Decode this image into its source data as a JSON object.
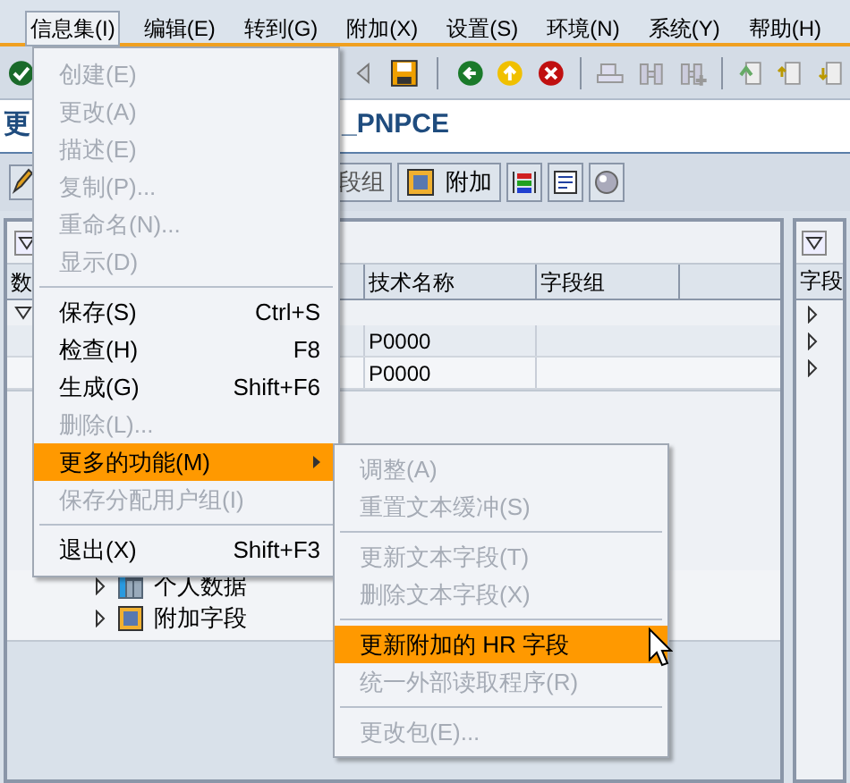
{
  "menu_bar": [
    {
      "label": "信息集(I)",
      "selected": true
    },
    {
      "label": "编辑(E)",
      "selected": false
    },
    {
      "label": "转到(G)",
      "selected": false
    },
    {
      "label": "附加(X)",
      "selected": false
    },
    {
      "label": "设置(S)",
      "selected": false
    },
    {
      "label": "环境(N)",
      "selected": false
    },
    {
      "label": "系统(Y)",
      "selected": false
    },
    {
      "label": "帮助(H)",
      "selected": false
    }
  ],
  "title": {
    "start": "更",
    "end": "_PNPCE"
  },
  "app_toolbar": {
    "partial_button": "段组",
    "button": "附加"
  },
  "table": {
    "columns": [
      {
        "label": "数"
      },
      {
        "label": "技术名称"
      },
      {
        "label": "字段组"
      }
    ],
    "rows": [
      {
        "technical_name": "P0000"
      },
      {
        "technical_name": "P0000"
      }
    ]
  },
  "tree": [
    {
      "label": "个人数据"
    },
    {
      "label": "附加字段"
    }
  ],
  "right_panel": {
    "column": "字段"
  },
  "menu": [
    {
      "kind": "item",
      "label": "创建(E)",
      "disabled": true,
      "selected": false
    },
    {
      "kind": "item",
      "label": "更改(A)",
      "disabled": true,
      "selected": false
    },
    {
      "kind": "item",
      "label": "描述(E)",
      "disabled": true,
      "selected": false
    },
    {
      "kind": "item",
      "label": "复制(P)...",
      "disabled": true,
      "selected": false
    },
    {
      "kind": "item",
      "label": "重命名(N)...",
      "disabled": true,
      "selected": false
    },
    {
      "kind": "item",
      "label": "显示(D)",
      "disabled": true,
      "selected": false
    },
    {
      "kind": "separator"
    },
    {
      "kind": "item",
      "label": "保存(S)",
      "shortcut": "Ctrl+S",
      "disabled": false,
      "selected": false
    },
    {
      "kind": "item",
      "label": "检查(H)",
      "shortcut": "F8",
      "disabled": false,
      "selected": false
    },
    {
      "kind": "item",
      "label": "生成(G)",
      "shortcut": "Shift+F6",
      "disabled": false,
      "selected": false
    },
    {
      "kind": "item",
      "label": "删除(L)...",
      "disabled": true,
      "selected": false
    },
    {
      "kind": "submenu",
      "label": "更多的功能(M)",
      "disabled": false,
      "selected": true
    },
    {
      "kind": "item",
      "label": "保存分配用户组(I)",
      "disabled": true,
      "selected": false
    },
    {
      "kind": "separator"
    },
    {
      "kind": "item",
      "label": "退出(X)",
      "shortcut": "Shift+F3",
      "disabled": false,
      "selected": false
    }
  ],
  "submenu": [
    {
      "kind": "item",
      "label": "调整(A)",
      "disabled": true,
      "selected": false
    },
    {
      "kind": "item",
      "label": "重置文本缓冲(S)",
      "disabled": true,
      "selected": false
    },
    {
      "kind": "separator"
    },
    {
      "kind": "item",
      "label": "更新文本字段(T)",
      "disabled": true,
      "selected": false
    },
    {
      "kind": "item",
      "label": "删除文本字段(X)",
      "disabled": true,
      "selected": false
    },
    {
      "kind": "separator"
    },
    {
      "kind": "item",
      "label": "更新附加的 HR 字段",
      "disabled": false,
      "selected": true
    },
    {
      "kind": "item",
      "label": "统一外部读取程序(R)",
      "disabled": true,
      "selected": false
    },
    {
      "kind": "separator"
    },
    {
      "kind": "item",
      "label": "更改包(E)...",
      "disabled": true,
      "selected": false
    }
  ]
}
